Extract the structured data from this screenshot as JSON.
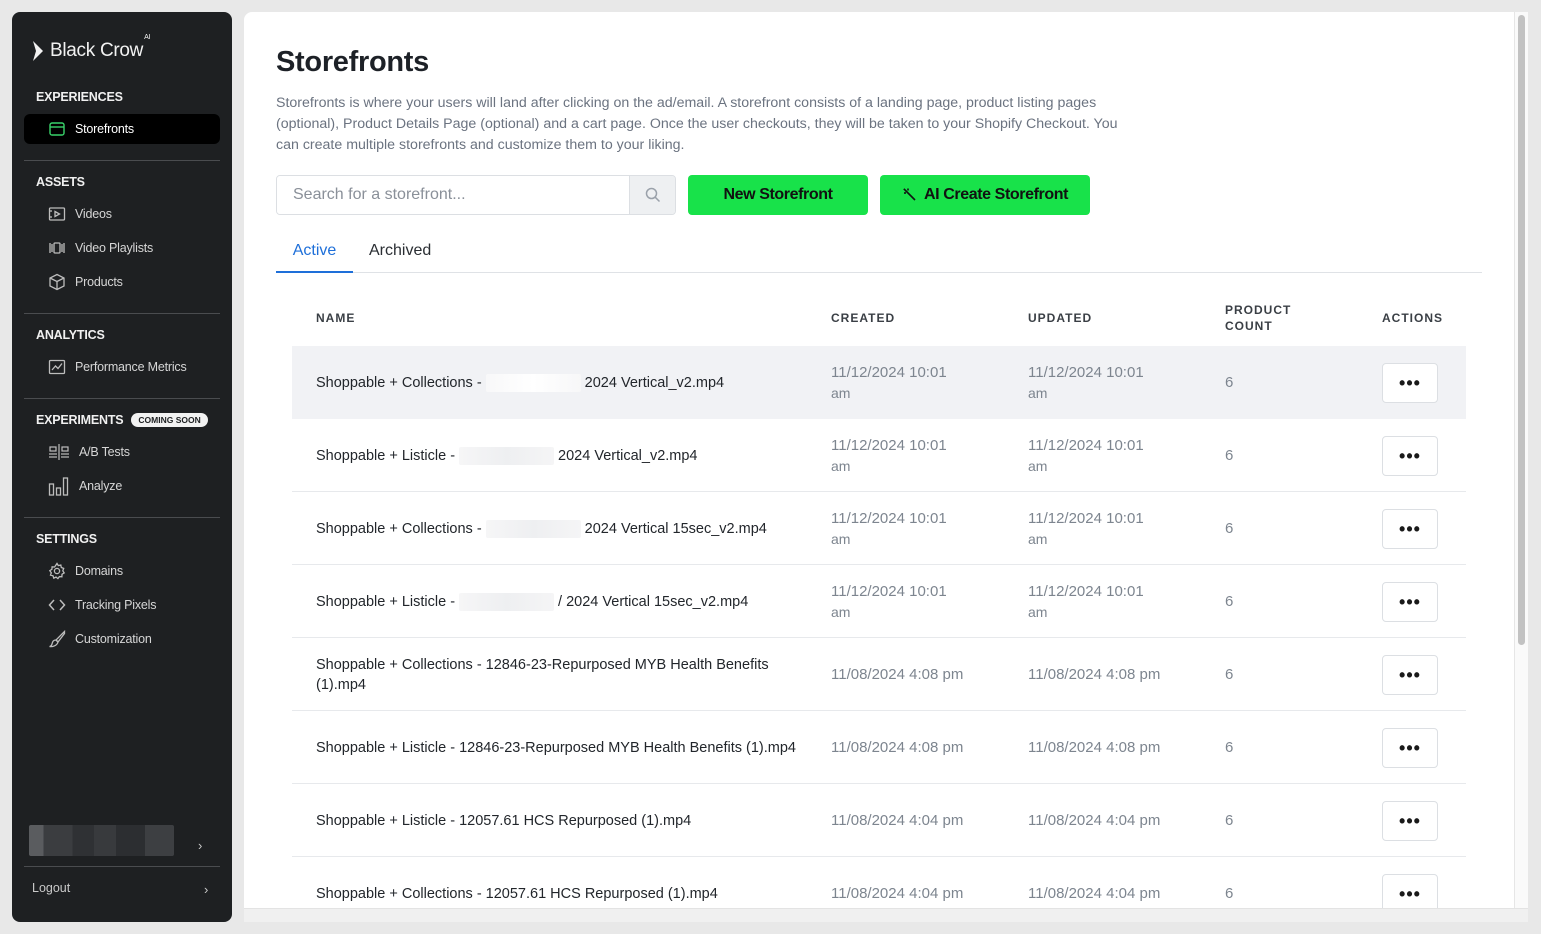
{
  "brand": {
    "name": "Black Crow",
    "sup": "AI"
  },
  "sidebar": {
    "sections": {
      "experiences": "EXPERIENCES",
      "assets": "ASSETS",
      "analytics": "ANALYTICS",
      "experiments": "EXPERIMENTS",
      "settings": "SETTINGS"
    },
    "coming_soon": "COMING SOON",
    "items": {
      "storefronts": "Storefronts",
      "videos": "Videos",
      "video_playlists": "Video Playlists",
      "products": "Products",
      "performance_metrics": "Performance Metrics",
      "ab_tests": "A/B Tests",
      "analyze": "Analyze",
      "domains": "Domains",
      "tracking_pixels": "Tracking Pixels",
      "customization": "Customization"
    },
    "logout": "Logout",
    "chevron": "›"
  },
  "page": {
    "title": "Storefronts",
    "description": "Storefronts is where your users will land after clicking on the ad/email. A storefront consists of a landing page, product listing pages (optional), Product Details Page (optional) and a cart page. Once the user checkouts, they will be taken to your Shopify Checkout. You can create multiple storefronts and customize them to your liking."
  },
  "search": {
    "placeholder": "Search for a storefront..."
  },
  "buttons": {
    "new_storefront": "New Storefront",
    "ai_create": "AI Create Storefront",
    "actions": "•••"
  },
  "tabs": {
    "active": "Active",
    "archived": "Archived"
  },
  "table": {
    "headers": {
      "name": "NAME",
      "created": "CREATED",
      "updated": "UPDATED",
      "product_count_1": "PRODUCT",
      "product_count_2": "COUNT",
      "actions": "ACTIONS"
    },
    "rows": [
      {
        "name_pre": "Shoppable + Collections -",
        "name_post": "2024 Vertical_v2.mp4",
        "redacted": true,
        "created_1": "11/12/2024 10:01",
        "created_2": "am",
        "updated_1": "11/12/2024 10:01",
        "updated_2": "am",
        "count": "6"
      },
      {
        "name_pre": "Shoppable + Listicle -",
        "name_post": "2024 Vertical_v2.mp4",
        "redacted": true,
        "created_1": "11/12/2024 10:01",
        "created_2": "am",
        "updated_1": "11/12/2024 10:01",
        "updated_2": "am",
        "count": "6"
      },
      {
        "name_pre": "Shoppable + Collections -",
        "name_post": "2024 Vertical 15sec_v2.mp4",
        "redacted": true,
        "created_1": "11/12/2024 10:01",
        "created_2": "am",
        "updated_1": "11/12/2024 10:01",
        "updated_2": "am",
        "count": "6"
      },
      {
        "name_pre": "Shoppable + Listicle -",
        "name_post": "/ 2024 Vertical 15sec_v2.mp4",
        "redacted": true,
        "created_1": "11/12/2024 10:01",
        "created_2": "am",
        "updated_1": "11/12/2024 10:01",
        "updated_2": "am",
        "count": "6"
      },
      {
        "name_pre": "Shoppable + Collections - 12846-23-Repurposed MYB Health Benefits (1).mp4",
        "name_post": "",
        "redacted": false,
        "created_1": "11/08/2024 4:08 pm",
        "created_2": "",
        "updated_1": "11/08/2024 4:08 pm",
        "updated_2": "",
        "count": "6"
      },
      {
        "name_pre": "Shoppable + Listicle - 12846-23-Repurposed MYB Health Benefits (1).mp4",
        "name_post": "",
        "redacted": false,
        "created_1": "11/08/2024 4:08 pm",
        "created_2": "",
        "updated_1": "11/08/2024 4:08 pm",
        "updated_2": "",
        "count": "6"
      },
      {
        "name_pre": "Shoppable + Listicle - 12057.61 HCS Repurposed (1).mp4",
        "name_post": "",
        "redacted": false,
        "created_1": "11/08/2024 4:04 pm",
        "created_2": "",
        "updated_1": "11/08/2024 4:04 pm",
        "updated_2": "",
        "count": "6"
      },
      {
        "name_pre": "Shoppable + Collections - 12057.61 HCS Repurposed (1).mp4",
        "name_post": "",
        "redacted": false,
        "created_1": "11/08/2024 4:04 pm",
        "created_2": "",
        "updated_1": "11/08/2024 4:04 pm",
        "updated_2": "",
        "count": "6"
      }
    ]
  },
  "colors": {
    "accent_green": "#18e24a",
    "tab_blue": "#1e6fd9",
    "sidebar_bg": "#1e2022"
  }
}
